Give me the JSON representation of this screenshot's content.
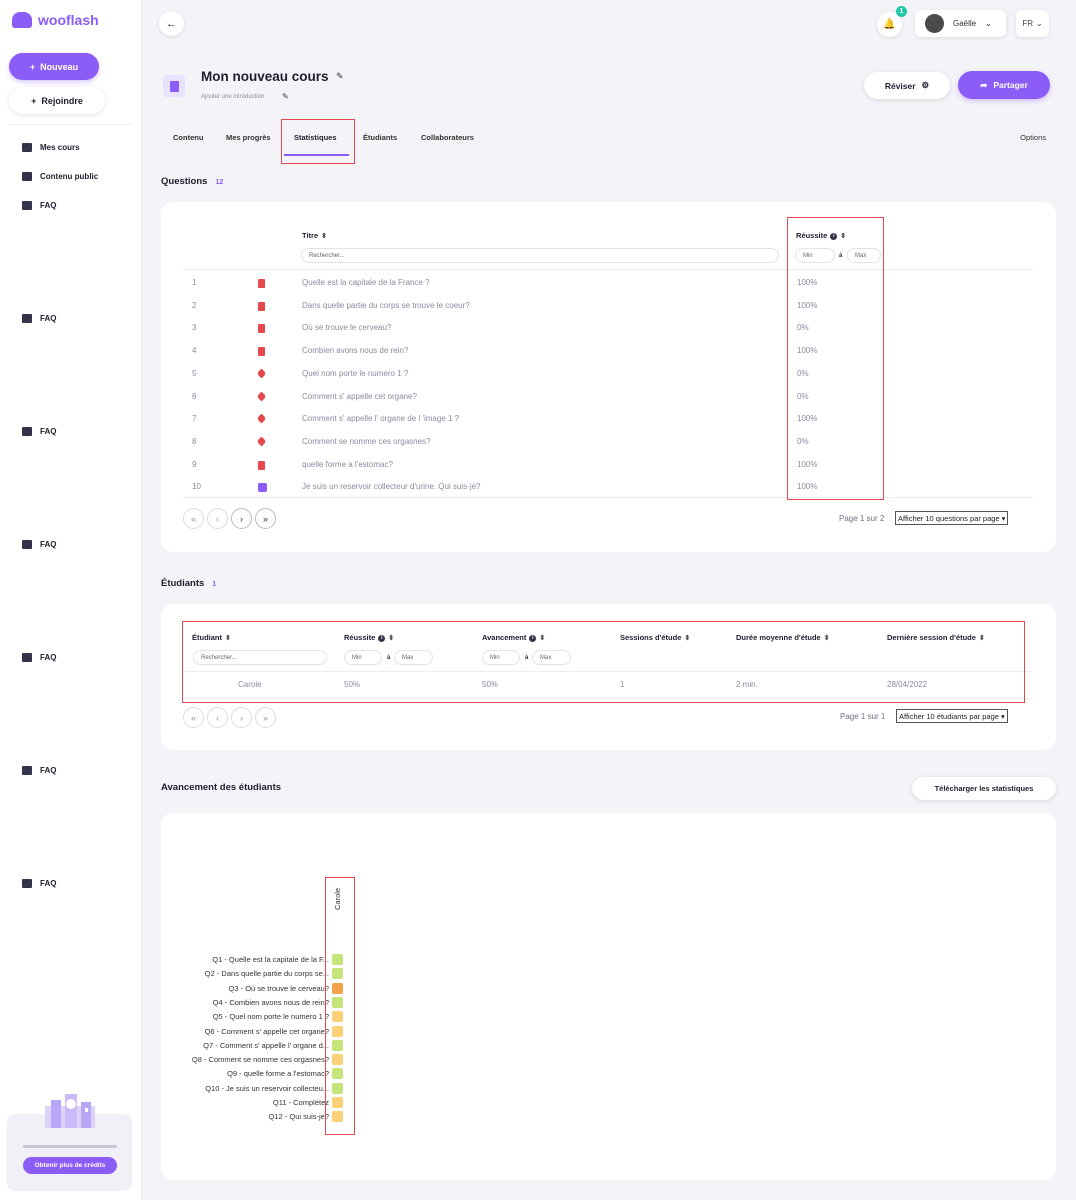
{
  "app": {
    "name": "wooflash"
  },
  "sidebar": {
    "new_label": "Nouveau",
    "join_label": "Rejoindre",
    "items": [
      {
        "label": "Mes cours",
        "icon": "courses-icon"
      },
      {
        "label": "Contenu public",
        "icon": "public-content-icon"
      },
      {
        "label": "FAQ",
        "icon": "faq-icon"
      },
      {
        "label": "FAQ",
        "icon": "faq-icon"
      },
      {
        "label": "FAQ",
        "icon": "faq-icon"
      },
      {
        "label": "FAQ",
        "icon": "faq-icon"
      },
      {
        "label": "FAQ",
        "icon": "faq-icon"
      },
      {
        "label": "FAQ",
        "icon": "faq-icon"
      },
      {
        "label": "FAQ",
        "icon": "faq-icon"
      }
    ],
    "credits_button": "Obtenir plus de crédits"
  },
  "header": {
    "notifications_count": "1",
    "user_name": "Gaëlle",
    "language": "FR"
  },
  "course": {
    "title": "Mon nouveau cours",
    "intro_placeholder": "Ajouter une introduction",
    "review_label": "Réviser",
    "share_label": "Partager"
  },
  "tabs": {
    "items": [
      "Contenu",
      "Mes progrès",
      "Statistiques",
      "Étudiants",
      "Collaborateurs"
    ],
    "active": "Statistiques",
    "options_label": "Options"
  },
  "questions": {
    "heading": "Questions",
    "count": "12",
    "col_title": "Titre",
    "col_success": "Réussite",
    "search_placeholder": "Rechercher...",
    "min_placeholder": "Min",
    "max_placeholder": "Max",
    "range_sep": "à",
    "rows": [
      {
        "num": "1",
        "type": "doc",
        "title": "Quelle est la capitale de la France ?",
        "success": "100%"
      },
      {
        "num": "2",
        "type": "doc",
        "title": "Dans quelle partie du corps se trouve le coeur?",
        "success": "100%"
      },
      {
        "num": "3",
        "type": "doc",
        "title": "Où se trouve le cerveau?",
        "success": "0%"
      },
      {
        "num": "4",
        "type": "doc",
        "title": "Combien avons nous de rein?",
        "success": "100%"
      },
      {
        "num": "5",
        "type": "tag",
        "title": "Quel nom porte le numero 1 ?",
        "success": "0%"
      },
      {
        "num": "6",
        "type": "tag",
        "title": "Comment s' appelle cet organe?",
        "success": "0%"
      },
      {
        "num": "7",
        "type": "tag",
        "title": "Comment s' appelle l' organe de l 'image 1 ?",
        "success": "100%"
      },
      {
        "num": "8",
        "type": "tag",
        "title": "Comment se nomme ces orgasnes?",
        "success": "0%"
      },
      {
        "num": "9",
        "type": "doc",
        "title": "quelle forme a l'estomac?",
        "success": "100%"
      },
      {
        "num": "10",
        "type": "img",
        "title": "Je suis un reservoir collecteur d'urine. Qui suis-je?",
        "success": "100%"
      }
    ],
    "page_info": "Page 1 sur 2",
    "per_page": "Afficher 10 questions par page"
  },
  "students": {
    "heading": "Étudiants",
    "count": "1",
    "col_student": "Étudiant",
    "col_success": "Réussite",
    "col_progress": "Avancement",
    "col_sessions": "Sessions d'étude",
    "col_duration": "Durée moyenne d'étude",
    "col_last": "Dernière session d'étude",
    "search_placeholder": "Rechercher...",
    "rows": [
      {
        "name": "Carole",
        "success": "50%",
        "progress": "50%",
        "sessions": "1",
        "duration": "2 min.",
        "last": "28/04/2022"
      }
    ],
    "page_info": "Page 1 sur 1",
    "per_page": "Afficher 10 étudiants par page"
  },
  "progress": {
    "heading": "Avancement des étudiants",
    "download_label": "Télécharger les statistiques",
    "student": "Carole",
    "rows": [
      {
        "label": "Q1 - Quelle est la capitale de la F...",
        "color": "#c5e57a"
      },
      {
        "label": "Q2 - Dans quelle partie du corps se...",
        "color": "#c5e57a"
      },
      {
        "label": "Q3 - Où se trouve le cerveau?",
        "color": "#f5a04a"
      },
      {
        "label": "Q4 - Combien avons nous de rein?",
        "color": "#c5e57a"
      },
      {
        "label": "Q5 - Quel nom porte le numero 1 ?",
        "color": "#fbd27a"
      },
      {
        "label": "Q6 - Comment s' appelle cet organe?",
        "color": "#fbd27a"
      },
      {
        "label": "Q7 - Comment s' appelle l' organe d...",
        "color": "#c5e57a"
      },
      {
        "label": "Q8 - Comment se nomme ces orgasnes?",
        "color": "#fbd27a"
      },
      {
        "label": "Q9 - quelle forme a l'estomac?",
        "color": "#c5e57a"
      },
      {
        "label": "Q10 - Je suis un reservoir collecteu...",
        "color": "#c5e57a"
      },
      {
        "label": "Q11 - Complétez",
        "color": "#fbd27a"
      },
      {
        "label": "Q12 - Qui suis-je?",
        "color": "#fbd27a"
      }
    ]
  }
}
